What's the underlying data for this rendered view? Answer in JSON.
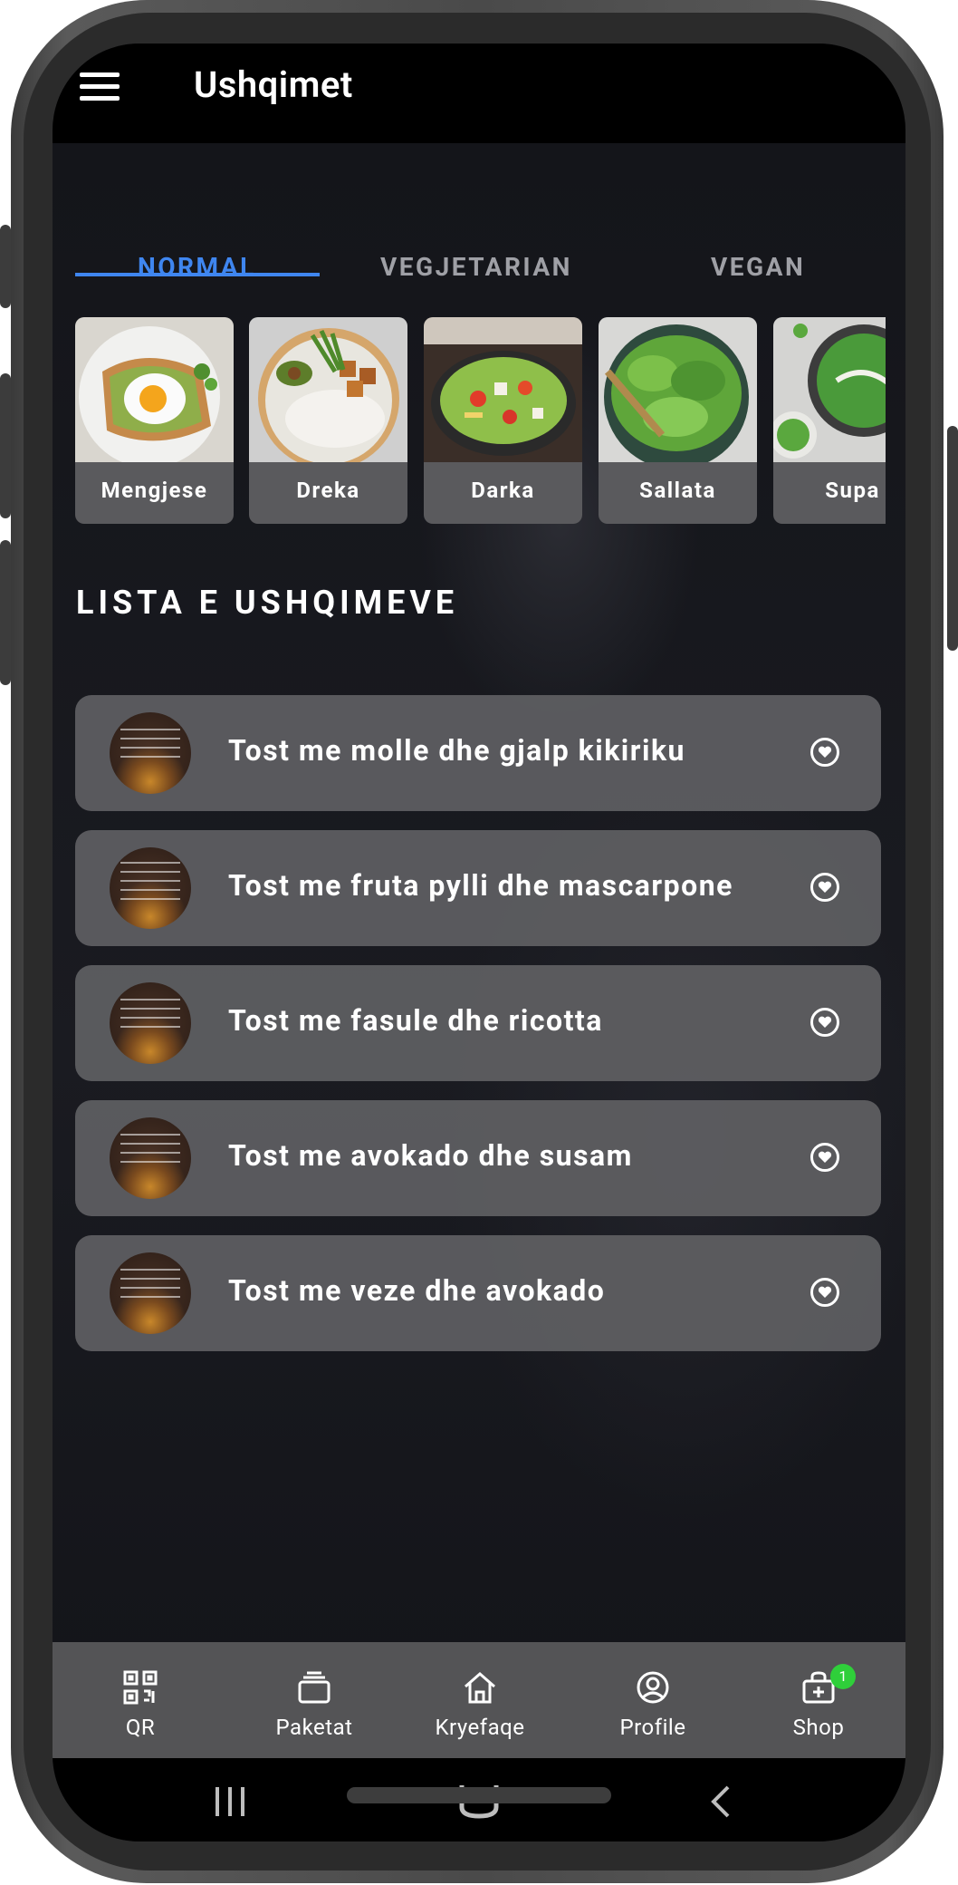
{
  "app": {
    "title": "Ushqimet"
  },
  "tabs": [
    {
      "label": "NORMAL",
      "active": true
    },
    {
      "label": "VEGJETARIAN",
      "active": false
    },
    {
      "label": "VEGAN",
      "active": false
    }
  ],
  "categories": [
    {
      "label": "Mengjese"
    },
    {
      "label": "Dreka"
    },
    {
      "label": "Darka"
    },
    {
      "label": "Sallata"
    },
    {
      "label": "Supa"
    }
  ],
  "section": {
    "title": "LISTA E USHQIMEVE"
  },
  "foods": [
    {
      "name": "Tost me molle dhe gjalp kikiriku"
    },
    {
      "name": "Tost me fruta pylli dhe mascarpone"
    },
    {
      "name": "Tost me fasule dhe ricotta"
    },
    {
      "name": "Tost me avokado dhe susam"
    },
    {
      "name": "Tost me veze dhe avokado"
    }
  ],
  "bottom_nav": [
    {
      "label": "QR",
      "icon": "qr-code-icon"
    },
    {
      "label": "Paketat",
      "icon": "packages-icon"
    },
    {
      "label": "Kryefaqe",
      "icon": "home-icon"
    },
    {
      "label": "Profile",
      "icon": "profile-icon"
    },
    {
      "label": "Shop",
      "icon": "shop-bag-icon",
      "badge": "1"
    }
  ],
  "colors": {
    "accent": "#3f86f0",
    "badge": "#2fcf3a",
    "background": "#14151a"
  }
}
